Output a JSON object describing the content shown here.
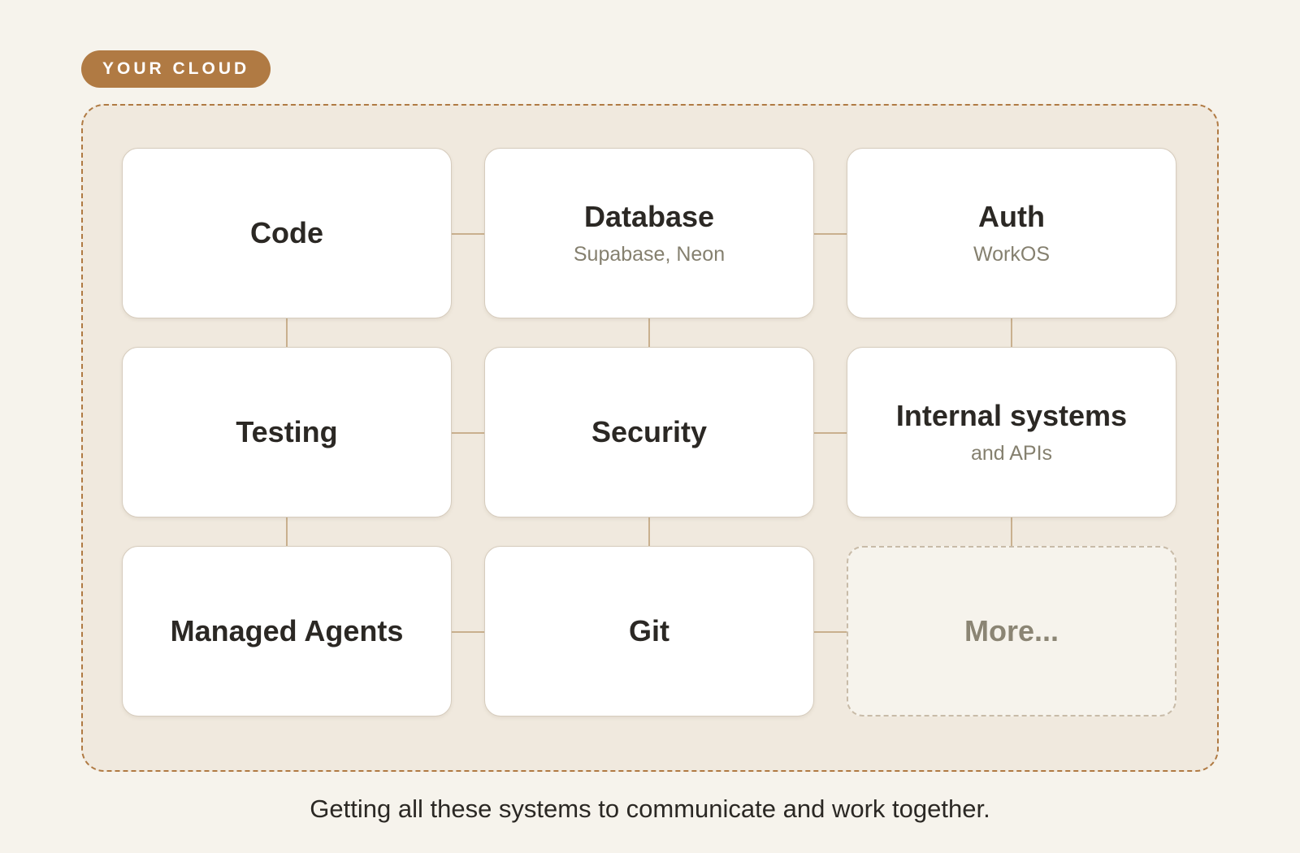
{
  "badge": {
    "label": "YOUR CLOUD"
  },
  "systems": [
    {
      "title": "Code",
      "subtitle": ""
    },
    {
      "title": "Database",
      "subtitle": "Supabase, Neon"
    },
    {
      "title": "Auth",
      "subtitle": "WorkOS"
    },
    {
      "title": "Testing",
      "subtitle": ""
    },
    {
      "title": "Security",
      "subtitle": ""
    },
    {
      "title": "Internal systems",
      "subtitle": "and APIs"
    },
    {
      "title": "Managed Agents",
      "subtitle": ""
    },
    {
      "title": "Git",
      "subtitle": ""
    },
    {
      "title": "More...",
      "subtitle": ""
    }
  ],
  "caption": "Getting all these systems to communicate and work together.",
  "colors": {
    "accent": "#b07a43",
    "background": "#f6f3ec",
    "cloud_fill": "#f0e9de",
    "connector": "#c9b08e",
    "title_text": "#2b2824",
    "subtitle_text": "#85806f"
  }
}
